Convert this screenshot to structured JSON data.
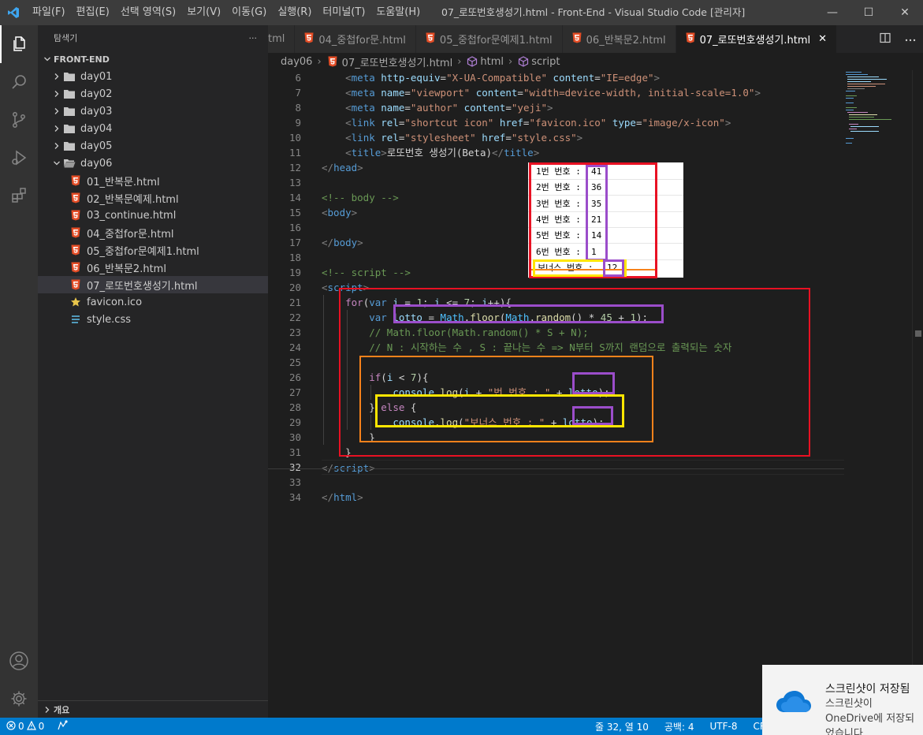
{
  "titlebar": {
    "menu": [
      "파일(F)",
      "편집(E)",
      "선택 영역(S)",
      "보기(V)",
      "이동(G)",
      "실행(R)",
      "터미널(T)",
      "도움말(H)"
    ],
    "title": "07_로또번호생성기.html - Front-End - Visual Studio Code [관리자]",
    "minimize": "—",
    "maximize": "☐",
    "close": "✕"
  },
  "sidebar": {
    "header": "탐색기",
    "more": "···",
    "root": "FRONT-END",
    "folders": [
      "day01",
      "day02",
      "day03",
      "day04",
      "day05"
    ],
    "open_folder": "day06",
    "files": [
      "01_반복문.html",
      "02_반복문예제.html",
      "03_continue.html",
      "04_중첩for문.html",
      "05_중첩for문예제1.html",
      "06_반복문2.html",
      "07_로또번호생성기.html"
    ],
    "root_files": [
      "favicon.ico",
      "style.css"
    ],
    "outline": "개요"
  },
  "tabs": [
    {
      "label": "tml",
      "active": false
    },
    {
      "label": "04_중첩for문.html",
      "active": false
    },
    {
      "label": "05_중첩for문예제1.html",
      "active": false
    },
    {
      "label": "06_반복문2.html",
      "active": false
    },
    {
      "label": "07_로또번호생성기.html",
      "active": true
    }
  ],
  "breadcrumb": [
    "day06",
    "07_로또번호생성기.html",
    "html",
    "script"
  ],
  "editor": {
    "line_numbers": [
      "6",
      "7",
      "8",
      "9",
      "10",
      "11",
      "12",
      "13",
      "14",
      "15",
      "16",
      "17",
      "18",
      "19",
      "20",
      "21",
      "22",
      "23",
      "24",
      "25",
      "26",
      "27",
      "28",
      "29",
      "30",
      "31",
      "32",
      "33",
      "34"
    ],
    "current_line": "32",
    "lines": [
      {
        "i": "    ",
        "p": [
          [
            "t",
            "<"
          ],
          [
            "k",
            "meta"
          ],
          [
            "d",
            " "
          ],
          [
            "a",
            "http-equiv"
          ],
          [
            "d",
            "="
          ],
          [
            "s",
            "\"X-UA-Compatible\""
          ],
          [
            "d",
            " "
          ],
          [
            "a",
            "content"
          ],
          [
            "d",
            "="
          ],
          [
            "s",
            "\"IE=edge\""
          ],
          [
            "t",
            ">"
          ]
        ]
      },
      {
        "i": "    ",
        "p": [
          [
            "t",
            "<"
          ],
          [
            "k",
            "meta"
          ],
          [
            "d",
            " "
          ],
          [
            "a",
            "name"
          ],
          [
            "d",
            "="
          ],
          [
            "s",
            "\"viewport\""
          ],
          [
            "d",
            " "
          ],
          [
            "a",
            "content"
          ],
          [
            "d",
            "="
          ],
          [
            "s",
            "\"width=device-width, initial-scale=1.0\""
          ],
          [
            "t",
            ">"
          ]
        ]
      },
      {
        "i": "    ",
        "p": [
          [
            "t",
            "<"
          ],
          [
            "k",
            "meta"
          ],
          [
            "d",
            " "
          ],
          [
            "a",
            "name"
          ],
          [
            "d",
            "="
          ],
          [
            "s",
            "\"author\""
          ],
          [
            "d",
            " "
          ],
          [
            "a",
            "content"
          ],
          [
            "d",
            "="
          ],
          [
            "s",
            "\"yeji\""
          ],
          [
            "t",
            ">"
          ]
        ]
      },
      {
        "i": "    ",
        "p": [
          [
            "t",
            "<"
          ],
          [
            "k",
            "link"
          ],
          [
            "d",
            " "
          ],
          [
            "a",
            "rel"
          ],
          [
            "d",
            "="
          ],
          [
            "s",
            "\"shortcut icon\""
          ],
          [
            "d",
            " "
          ],
          [
            "a",
            "href"
          ],
          [
            "d",
            "="
          ],
          [
            "s",
            "\"favicon.ico\""
          ],
          [
            "d",
            " "
          ],
          [
            "a",
            "type"
          ],
          [
            "d",
            "="
          ],
          [
            "s",
            "\"image/x-icon\""
          ],
          [
            "t",
            ">"
          ]
        ]
      },
      {
        "i": "    ",
        "p": [
          [
            "t",
            "<"
          ],
          [
            "k",
            "link"
          ],
          [
            "d",
            " "
          ],
          [
            "a",
            "rel"
          ],
          [
            "d",
            "="
          ],
          [
            "s",
            "\"stylesheet\""
          ],
          [
            "d",
            " "
          ],
          [
            "a",
            "href"
          ],
          [
            "d",
            "="
          ],
          [
            "s",
            "\"style.css\""
          ],
          [
            "t",
            ">"
          ]
        ]
      },
      {
        "i": "    ",
        "p": [
          [
            "t",
            "<"
          ],
          [
            "k",
            "title"
          ],
          [
            "t",
            ">"
          ],
          [
            "d",
            "로또번호 생성기(Beta)"
          ],
          [
            "t",
            "</"
          ],
          [
            "k",
            "title"
          ],
          [
            "t",
            ">"
          ]
        ]
      },
      {
        "i": "",
        "p": [
          [
            "t",
            "</"
          ],
          [
            "k",
            "head"
          ],
          [
            "t",
            ">"
          ]
        ]
      },
      {
        "i": "",
        "p": []
      },
      {
        "i": "",
        "p": [
          [
            "c",
            "<!-- body -->"
          ]
        ]
      },
      {
        "i": "",
        "p": [
          [
            "t",
            "<"
          ],
          [
            "k",
            "body"
          ],
          [
            "t",
            ">"
          ]
        ]
      },
      {
        "i": "",
        "p": []
      },
      {
        "i": "",
        "p": [
          [
            "t",
            "</"
          ],
          [
            "k",
            "body"
          ],
          [
            "t",
            ">"
          ]
        ]
      },
      {
        "i": "",
        "p": []
      },
      {
        "i": "",
        "p": [
          [
            "c",
            "<!-- script -->"
          ]
        ]
      },
      {
        "i": "",
        "p": [
          [
            "t",
            "<"
          ],
          [
            "k",
            "script"
          ],
          [
            "t",
            ">"
          ]
        ]
      },
      {
        "i": "    ",
        "p": [
          [
            "cn",
            "for"
          ],
          [
            "d",
            "("
          ],
          [
            "k",
            "var"
          ],
          [
            "d",
            " "
          ],
          [
            "a",
            "i"
          ],
          [
            "d",
            " = "
          ],
          [
            "n",
            "1"
          ],
          [
            "d",
            "; "
          ],
          [
            "a",
            "i"
          ],
          [
            "d",
            " <= "
          ],
          [
            "n",
            "7"
          ],
          [
            "d",
            "; "
          ],
          [
            "a",
            "i"
          ],
          [
            "d",
            "++){"
          ]
        ]
      },
      {
        "i": "        ",
        "p": [
          [
            "k",
            "var"
          ],
          [
            "d",
            " "
          ],
          [
            "a",
            "lotto"
          ],
          [
            "d",
            " = "
          ],
          [
            "v",
            "Math"
          ],
          [
            "d",
            "."
          ],
          [
            "f",
            "floor"
          ],
          [
            "d",
            "("
          ],
          [
            "v",
            "Math"
          ],
          [
            "d",
            "."
          ],
          [
            "f",
            "random"
          ],
          [
            "d",
            "() * "
          ],
          [
            "n",
            "45"
          ],
          [
            "d",
            " + "
          ],
          [
            "n",
            "1"
          ],
          [
            "d",
            ");"
          ]
        ]
      },
      {
        "i": "        ",
        "p": [
          [
            "c",
            "// Math.floor(Math.random() * S + N);"
          ]
        ]
      },
      {
        "i": "        ",
        "p": [
          [
            "c",
            "// N : 시작하는 수 , S : 끝나는 수 => N부터 S까지 랜덤으로 출력되는 숫자"
          ]
        ]
      },
      {
        "i": "",
        "p": []
      },
      {
        "i": "        ",
        "p": [
          [
            "cn",
            "if"
          ],
          [
            "d",
            "("
          ],
          [
            "a",
            "i"
          ],
          [
            "d",
            " < "
          ],
          [
            "n",
            "7"
          ],
          [
            "d",
            "){"
          ]
        ]
      },
      {
        "i": "            ",
        "p": [
          [
            "a",
            "console"
          ],
          [
            "d",
            "."
          ],
          [
            "f",
            "log"
          ],
          [
            "d",
            "("
          ],
          [
            "a",
            "i"
          ],
          [
            "d",
            " + "
          ],
          [
            "s",
            "\"번 번호 : \""
          ],
          [
            "d",
            " + "
          ],
          [
            "a",
            "lotto"
          ],
          [
            "d",
            ");"
          ]
        ]
      },
      {
        "i": "        ",
        "p": [
          [
            "d",
            "} "
          ],
          [
            "cn",
            "else"
          ],
          [
            "d",
            " {"
          ]
        ]
      },
      {
        "i": "            ",
        "p": [
          [
            "a",
            "console"
          ],
          [
            "d",
            "."
          ],
          [
            "f",
            "log"
          ],
          [
            "d",
            "("
          ],
          [
            "s",
            "\"보너스 번호 : \""
          ],
          [
            "d",
            " + "
          ],
          [
            "a",
            "lotto"
          ],
          [
            "d",
            ");"
          ]
        ]
      },
      {
        "i": "        ",
        "p": [
          [
            "d",
            "}"
          ]
        ]
      },
      {
        "i": "    ",
        "p": [
          [
            "d",
            "}"
          ]
        ]
      },
      {
        "i": "",
        "p": [
          [
            "t",
            "</"
          ],
          [
            "k",
            "script"
          ],
          [
            "t",
            ">"
          ]
        ]
      },
      {
        "i": "",
        "p": []
      },
      {
        "i": "",
        "p": [
          [
            "t",
            "</"
          ],
          [
            "k",
            "html"
          ],
          [
            "t",
            ">"
          ]
        ]
      }
    ]
  },
  "console_output": {
    "rows": [
      {
        "label": "1번 번호 :",
        "value": "41"
      },
      {
        "label": "2번 번호 :",
        "value": "36"
      },
      {
        "label": "3번 번호 :",
        "value": "35"
      },
      {
        "label": "4번 번호 :",
        "value": "21"
      },
      {
        "label": "5번 번호 :",
        "value": "14"
      },
      {
        "label": "6번 번호 :",
        "value": "1"
      }
    ],
    "bonus_label": "보너스 번호 :",
    "bonus_value": "12"
  },
  "statusbar": {
    "errors": "0",
    "warnings": "0",
    "position": "줄 32, 열 10",
    "indent": "공백: 4",
    "encoding": "UTF-8",
    "eol": "CRLF"
  },
  "toast": {
    "title": "스크린샷이 저장됨",
    "body": "스크린샷이 OneDrive에 저장되었습니다."
  },
  "colors": {
    "accent": "#007acc",
    "highlight_red": "#e81123",
    "highlight_orange": "#f7821b",
    "highlight_purple": "#9b4dca",
    "highlight_yellow": "#ffe600"
  }
}
